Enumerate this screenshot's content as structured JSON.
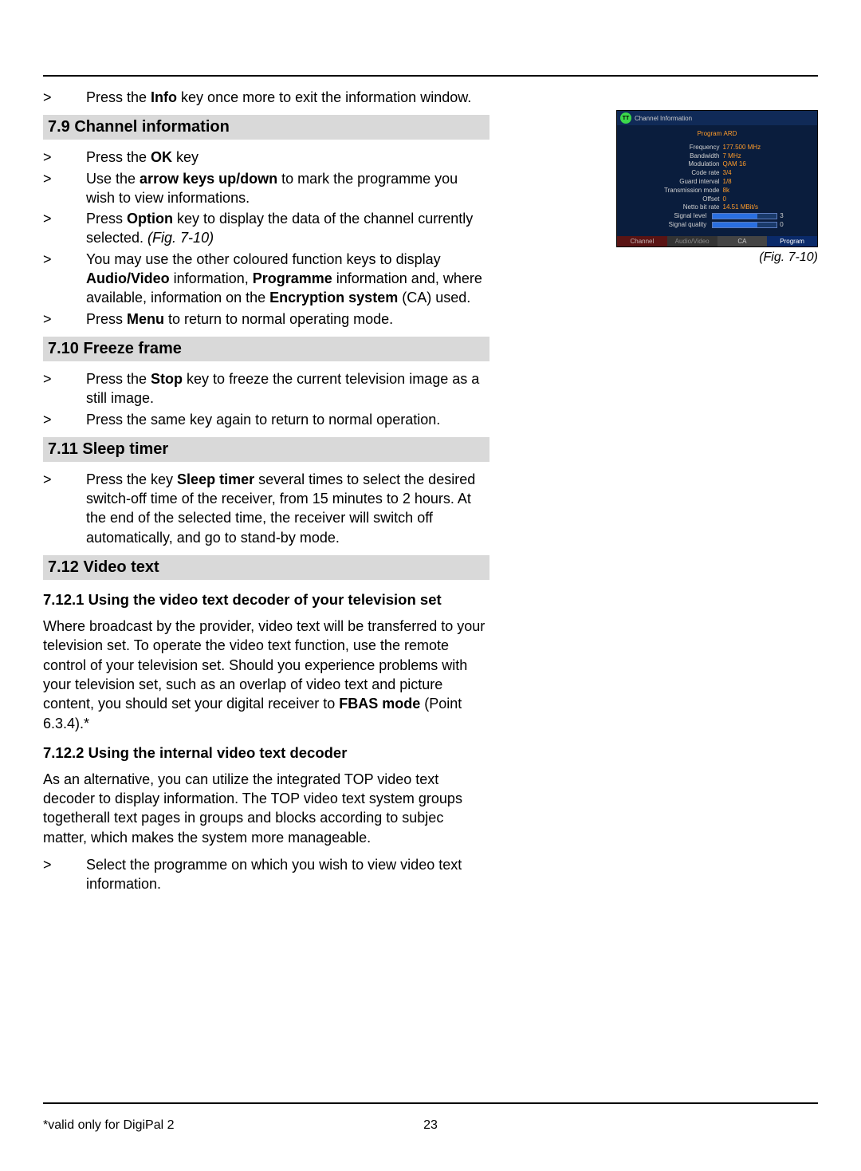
{
  "intro": {
    "b1": {
      "pre": "Press the ",
      "bold": "Info",
      "post": " key once more to exit the information window."
    }
  },
  "sec79": {
    "heading": "7.9 Channel information",
    "b1": {
      "pre": "Press the ",
      "bold": "OK",
      "post": " key"
    },
    "b2": {
      "pre": "Use the ",
      "bold": "arrow keys up/down",
      "post": " to mark the programme you wish to view informations."
    },
    "b3": {
      "pre": "Press ",
      "bold": "Option",
      "post": " key to display the data of the channel currently selected. ",
      "ital": "(Fig. 7-10)"
    },
    "b4": {
      "pre": "You may use the other coloured function keys to display ",
      "bold1": "Audio/Video",
      "mid1": " information, ",
      "bold2": "Programme",
      "mid2": " information and, where available, information on the ",
      "bold3": "Encryption system",
      "post": " (CA) used."
    },
    "b5": {
      "pre": "Press ",
      "bold": "Menu",
      "post": " to return to normal operating mode."
    }
  },
  "sec710": {
    "heading": "7.10 Freeze frame",
    "b1": {
      "pre": "Press the ",
      "bold": "Stop",
      "post": " key to freeze the current television image as a still image."
    },
    "b2": {
      "text": "Press the same key again to return to normal operation."
    }
  },
  "sec711": {
    "heading": "7.11 Sleep timer",
    "b1": {
      "pre": "Press the key ",
      "bold": "Sleep timer",
      "post": " several times to select the desired switch-off time of the receiver, from 15 minutes to 2 hours. At the end of the selected time, the receiver will switch off automatically, and go to stand-by mode."
    }
  },
  "sec712": {
    "heading": "7.12 Video text",
    "sub1": "7.12.1 Using the video text decoder of your television set",
    "p1_pre": "Where broadcast by the provider, video text will be transferred to your television set. To operate the video text function, use the remote control of your television set. Should you experience problems with your television set, such as an overlap of video text and picture content, you should set your digital receiver to ",
    "p1_bold": "FBAS mode",
    "p1_post": " (Point 6.3.4).*",
    "sub2": "7.12.2 Using the internal video text decoder",
    "p2": "As an alternative, you can utilize the integrated TOP video text decoder to display information. The TOP video text system groups togetherall text pages in groups and blocks according to subjec matter, which makes the system more manageable.",
    "b1": {
      "text": "Select the programme on which you wish to view video text information."
    }
  },
  "footer": {
    "note": "*valid only for DigiPal 2",
    "page": "23"
  },
  "fig": {
    "caption": "(Fig. 7-10)",
    "title": "Channel Information",
    "program_label": "Program",
    "program_value": "ARD",
    "rows": [
      {
        "k": "Frequency",
        "v": "177.500 MHz"
      },
      {
        "k": "Bandwidth",
        "v": "7 MHz"
      },
      {
        "k": "Modulation",
        "v": "QAM 16"
      },
      {
        "k": "Code rate",
        "v": "3/4"
      },
      {
        "k": "Guard interval",
        "v": "1/8"
      },
      {
        "k": "Transmission mode",
        "v": "8k"
      },
      {
        "k": "Offset",
        "v": "0"
      },
      {
        "k": "Netto bit rate",
        "v": "14.51 MBit/s"
      }
    ],
    "sig_level_label": "Signal level",
    "sig_level_val": "3",
    "sig_qual_label": "Signal quality",
    "sig_qual_val": "0",
    "tabs": {
      "channel": "Channel",
      "av": "Audio/Video",
      "ca": "CA",
      "program": "Program"
    }
  },
  "mark": ">"
}
